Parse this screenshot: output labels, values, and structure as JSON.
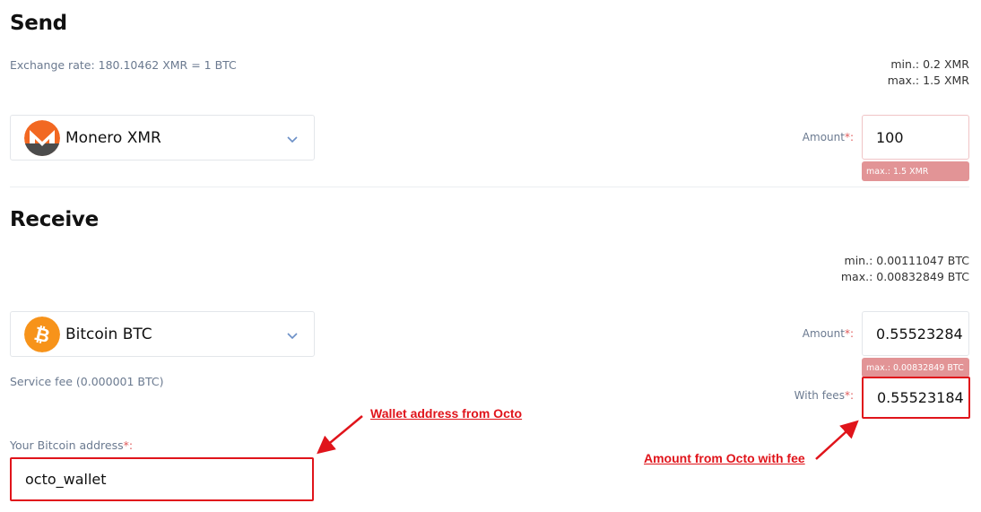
{
  "send": {
    "title": "Send",
    "exchange_rate": "Exchange rate: 180.10462 XMR = 1 BTC",
    "min": "min.: 0.2 XMR",
    "max": "max.: 1.5 XMR",
    "currency": "Monero XMR",
    "amount_label": "Amount",
    "amount_value": "100",
    "amount_error": "max.: 1.5 XMR"
  },
  "receive": {
    "title": "Receive",
    "min": "min.: 0.00111047 BTC",
    "max": "max.: 0.00832849 BTC",
    "currency": "Bitcoin BTC",
    "amount_label": "Amount",
    "amount_value": "0.55523284",
    "amount_error": "max.: 0.00832849 BTC",
    "service_fee": "Service fee (0.000001 BTC)",
    "with_fees_label": "With fees",
    "with_fees_value": "0.55523184",
    "address_label": "Your Bitcoin address",
    "address_value": "octo_wallet"
  },
  "required_mark": "*:",
  "annotations": {
    "wallet": "Wallet address from Octo",
    "amount": "Amount from Octo with fee"
  },
  "colors": {
    "monero_orange": "#f26822",
    "monero_gray": "#4c4c4c",
    "bitcoin_orange": "#f7931a",
    "annotation_red": "#e0141b",
    "error_badge": "#e29496"
  },
  "icons": {
    "monero": "monero-logo-icon",
    "bitcoin": "bitcoin-logo-icon",
    "chevron": "chevron-down-icon",
    "arrow": "annotation-arrow-icon"
  }
}
